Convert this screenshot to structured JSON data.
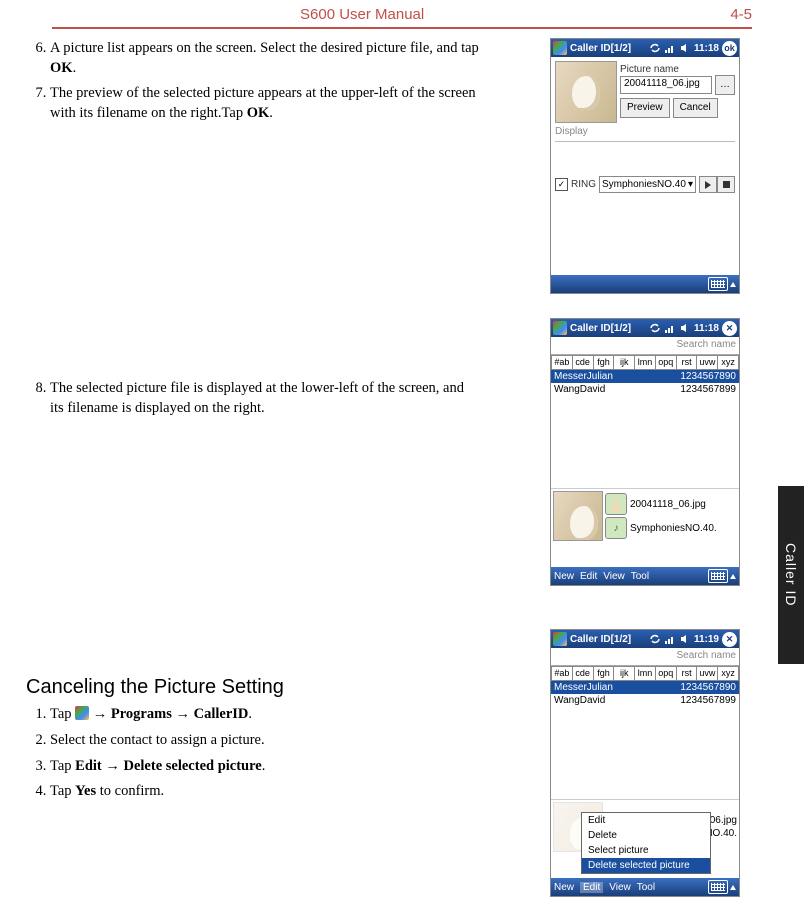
{
  "header": {
    "title": "S600 User Manual",
    "page": "4-5"
  },
  "side_tab": "Caller ID",
  "steps_a": [
    {
      "n": "6",
      "text_a": "A picture list appears on the screen. Select the desired picture file, and tap ",
      "bold": "OK",
      "text_b": "."
    },
    {
      "n": "7",
      "text_a": "The preview of the selected picture appears at the upper-left of the screen with its filename on the right.Tap ",
      "bold": "OK",
      "text_b": "."
    }
  ],
  "steps_b": [
    {
      "n": "8",
      "text_a": "The selected picture file is displayed at the lower-left of the screen, and its filename is displayed on the right.",
      "bold": "",
      "text_b": ""
    }
  ],
  "section_title": "Canceling the Picture Setting",
  "steps_c": [
    {
      "n": "1",
      "parts": [
        "Tap ",
        "START_ICON",
        " → ",
        "B:Programs",
        " → ",
        "B:CallerID",
        "."
      ]
    },
    {
      "n": "2",
      "parts": [
        "Select the contact to assign a picture."
      ]
    },
    {
      "n": "3",
      "parts": [
        "Tap ",
        "B:Edit",
        " → ",
        "B:Delete selected picture",
        "."
      ]
    },
    {
      "n": "4",
      "parts": [
        "Tap ",
        "B:Yes",
        " to confirm."
      ]
    }
  ],
  "shot": {
    "title": "Caller ID[1/2]",
    "time1": "11:18",
    "time2": "11:18",
    "time3": "11:19",
    "picture_name_label": "Picture name",
    "picture_name_value": "20041118_06.jpg",
    "preview_btn": "Preview",
    "cancel_btn": "Cancel",
    "display_label": "Display",
    "ring_label": "RING",
    "ring_value": "SymphoniesNO.40",
    "search_placeholder": "Search name",
    "alpha_tabs": [
      "#ab",
      "cde",
      "fgh",
      "ijk",
      "lmn",
      "opq",
      "rst",
      "uvw",
      "xyz"
    ],
    "contacts": [
      {
        "name": "MesserJulian",
        "number": "1234567890",
        "selected": true
      },
      {
        "name": "WangDavid",
        "number": "1234567899",
        "selected": false
      }
    ],
    "file_pic": "20041118_06.jpg",
    "file_ring": "SymphoniesNO.40.",
    "menu_items": [
      "New",
      "Edit",
      "View",
      "Tool"
    ],
    "ctx_menu": [
      "Edit",
      "Delete",
      "Select picture",
      "Delete selected picture"
    ],
    "ctx_highlight": 3
  }
}
